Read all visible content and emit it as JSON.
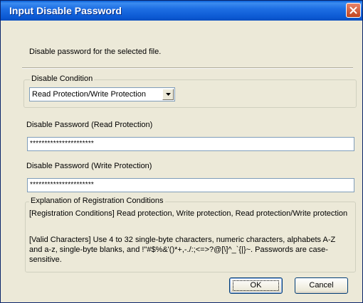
{
  "window": {
    "title": "Input Disable Password"
  },
  "description": "Disable password for the selected file.",
  "disable_condition": {
    "legend": "Disable Condition",
    "selected": "Read Protection/Write Protection"
  },
  "read_password": {
    "label": "Disable Password (Read Protection)",
    "value": "**********************"
  },
  "write_password": {
    "label": "Disable Password (Write Protection)",
    "value": "**********************"
  },
  "explanation": {
    "legend": "Explanation of Registration Conditions",
    "conditions": "[Registration Conditions] Read protection, Write protection, Read protection/Write protection",
    "valid_chars": "[Valid Characters] Use 4 to 32 single-byte characters, numeric characters, alphabets A-Z and a-z, single-byte blanks, and !\"#$%&'()*+,-./:;<=>?@[\\]^_`{|}~. Passwords are case-sensitive."
  },
  "buttons": {
    "ok": "OK",
    "cancel": "Cancel"
  },
  "icons": {
    "close": "close-icon",
    "dropdown": "chevron-down-icon"
  },
  "colors": {
    "titlebar": "#0b58d2",
    "close": "#c0441f",
    "dialog_bg": "#ece9d8",
    "input_border": "#7f9db9"
  }
}
